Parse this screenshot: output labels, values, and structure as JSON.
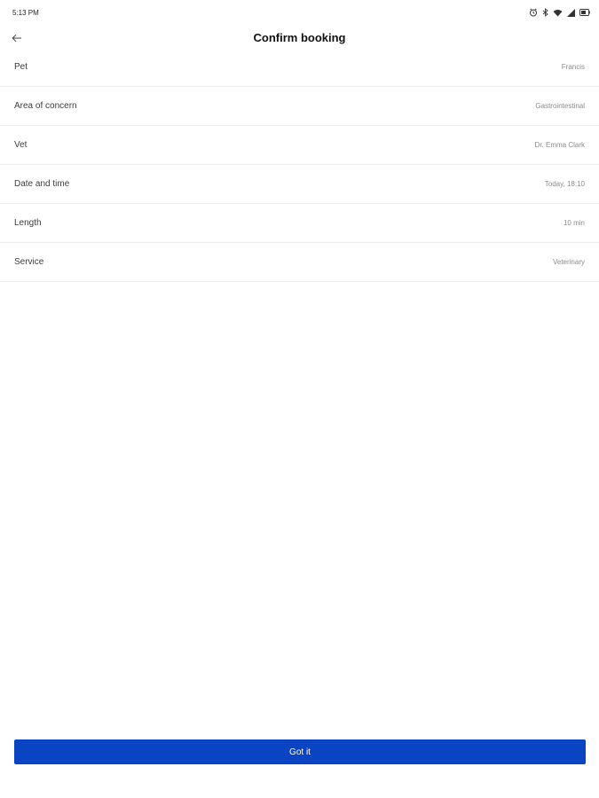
{
  "status_bar": {
    "time": "5:13 PM",
    "icons": [
      "alarm-icon",
      "bluetooth-icon",
      "wifi-icon",
      "signal-icon",
      "battery-icon"
    ]
  },
  "header": {
    "back_icon": "arrow-left-icon",
    "title": "Confirm booking"
  },
  "details": [
    {
      "label": "Pet",
      "value": "Francis"
    },
    {
      "label": "Area of concern",
      "value": "Gastrointestinal"
    },
    {
      "label": "Vet",
      "value": "Dr. Emma Clark"
    },
    {
      "label": "Date and time",
      "value": "Today, 18:10"
    },
    {
      "label": "Length",
      "value": "10 min"
    },
    {
      "label": "Service",
      "value": "Veterinary"
    }
  ],
  "actions": {
    "confirm_label": "Got it"
  },
  "colors": {
    "primary": "#0a44c3",
    "divider": "#ececec"
  }
}
